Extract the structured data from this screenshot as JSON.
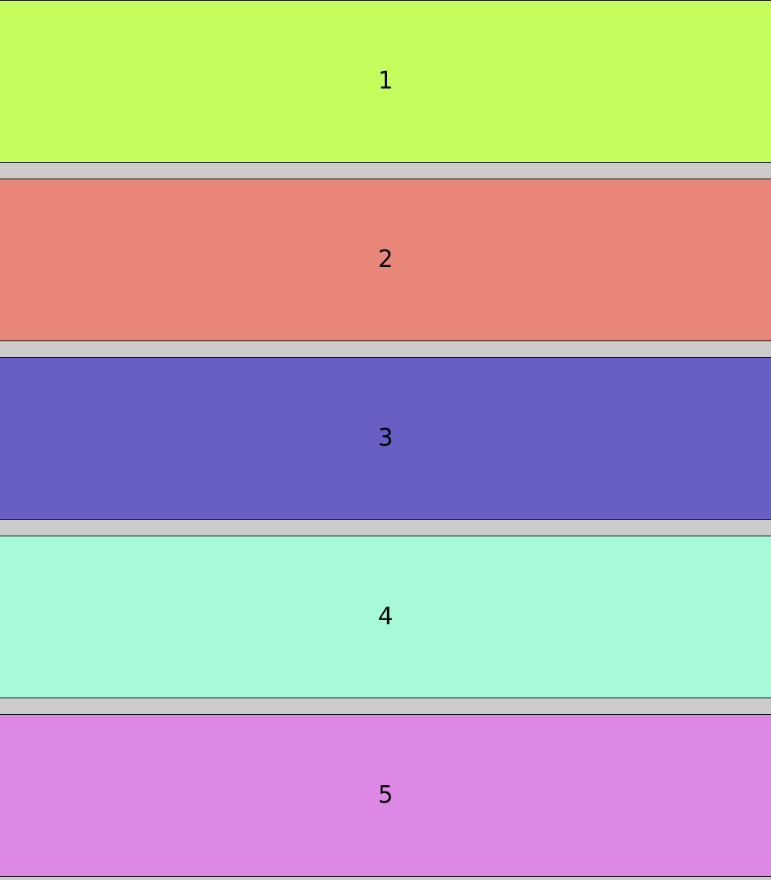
{
  "items": [
    {
      "label": "1",
      "color": "#c5fe5c"
    },
    {
      "label": "2",
      "color": "#e88778"
    },
    {
      "label": "3",
      "color": "#675fc4"
    },
    {
      "label": "4",
      "color": "#a7fad8"
    },
    {
      "label": "5",
      "color": "#dc88e4"
    }
  ]
}
